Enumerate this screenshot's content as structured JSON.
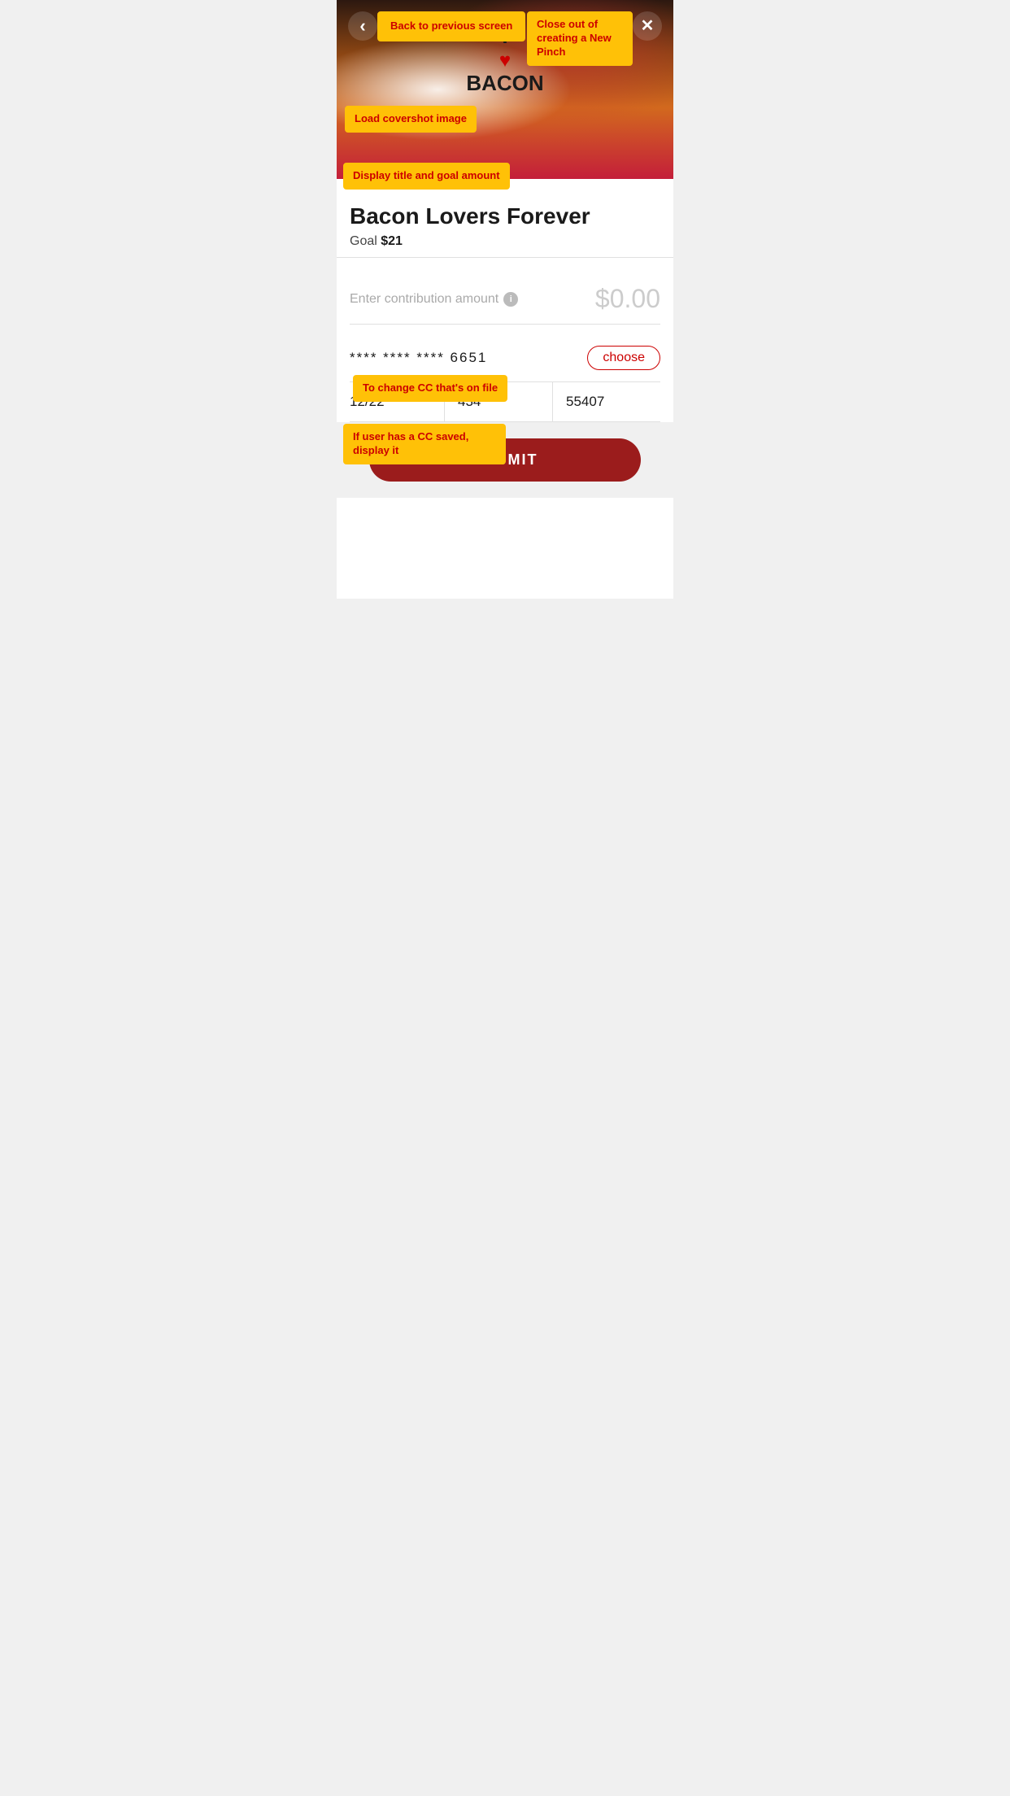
{
  "header": {
    "back_label": "Back to previous screen",
    "close_label": "Close out of creating a New Pinch"
  },
  "cover": {
    "shirt_line1": "I",
    "shirt_heart": "♥",
    "shirt_line2": "BACON",
    "tooltip_covershot": "Load covershot image",
    "tooltip_display": "Display title and goal amount"
  },
  "pinch": {
    "title": "Bacon Lovers Forever",
    "goal_label": "Goal",
    "goal_amount": "$21"
  },
  "contribution": {
    "label": "Enter contribution amount",
    "info_icon": "i",
    "amount": "$0.00"
  },
  "cc": {
    "masked_number": "**** **** **** 6651",
    "choose_label": "choose",
    "expiry": "12/22",
    "cvv": "434",
    "zip": "55407",
    "tooltip_change": "To change CC that's on file",
    "tooltip_saved": "If user has a CC saved, display it"
  },
  "submit": {
    "label": "SUBMIT"
  },
  "icons": {
    "back": "‹",
    "close": "✕"
  }
}
